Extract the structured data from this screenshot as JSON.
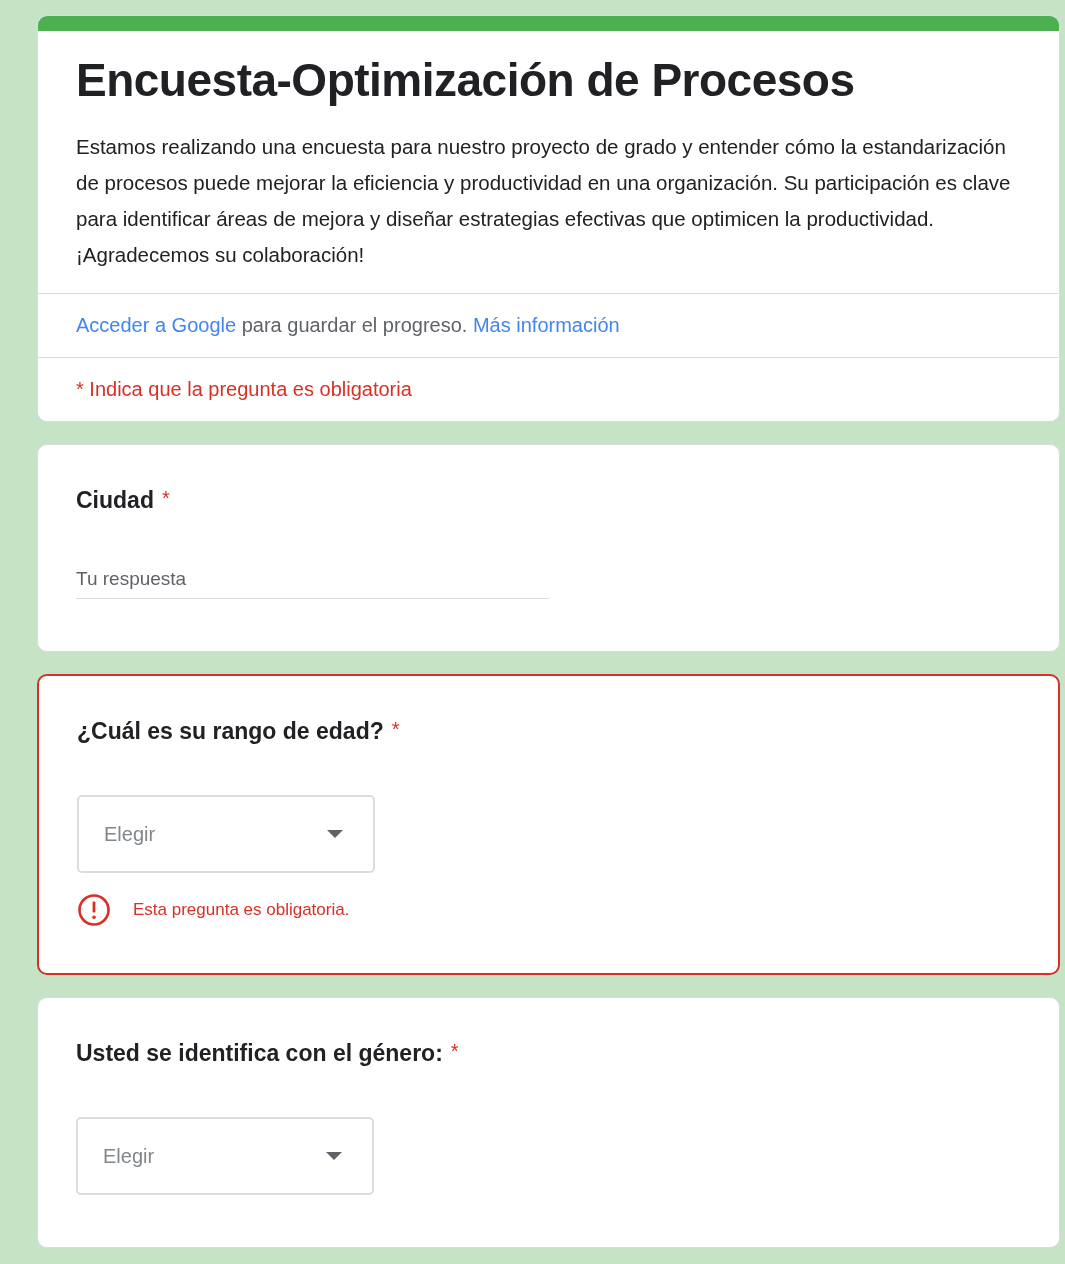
{
  "header": {
    "title": "Encuesta-Optimización de Procesos",
    "description": "Estamos realizando una encuesta para nuestro proyecto de grado y entender cómo la estandarización de procesos puede mejorar la eficiencia y productividad en una organización. Su participación es clave para identificar áreas de mejora y diseñar estrategias efectivas que optimicen la productividad. ¡Agradecemos su colaboración!",
    "sign_in": {
      "link": "Acceder a Google",
      "text": "para guardar el progreso.",
      "more_link": "Más información"
    },
    "required_note": "* Indica que la pregunta es obligatoria"
  },
  "questions": [
    {
      "kind": "text",
      "title": "Ciudad",
      "required_mark": "*",
      "placeholder": "Tu respuesta",
      "error": false
    },
    {
      "kind": "dropdown",
      "title": "¿Cuál es su rango de edad?",
      "required_mark": "*",
      "placeholder": "Elegir",
      "error": true,
      "error_text": "Esta pregunta es obligatoria."
    },
    {
      "kind": "dropdown",
      "title": "Usted se identifica con el género:",
      "required_mark": "*",
      "placeholder": "Elegir",
      "error": false
    }
  ]
}
